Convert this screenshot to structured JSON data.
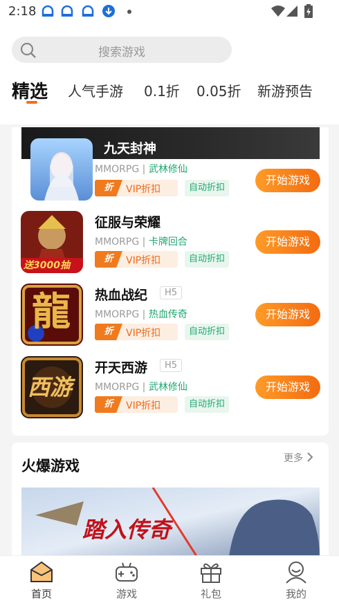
{
  "status_bar": {
    "time": "2:18",
    "notification_icons": [
      "app-notification-icon",
      "app-notification-icon",
      "app-notification-icon",
      "download-icon"
    ],
    "right_icons": [
      "wifi-icon",
      "signal-icon",
      "battery-icon"
    ]
  },
  "search": {
    "placeholder": "搜索游戏",
    "icon": "search-icon"
  },
  "tabs": [
    {
      "label": "精选",
      "active": true
    },
    {
      "label": "人气手游"
    },
    {
      "label": "0.1折"
    },
    {
      "label": "0.05折"
    },
    {
      "label": "新游预告"
    }
  ],
  "featured": {
    "title": "九天封神"
  },
  "games": [
    {
      "name": "九天封神",
      "type": "MMORPG |",
      "genre": "武林修仙",
      "vip_tag": "VIP折扣",
      "zhe": "折",
      "auto_tag": "自动折扣",
      "button": "开始游戏"
    },
    {
      "name": "征服与荣耀",
      "type": "MMORPG |",
      "genre": "卡牌回合",
      "vip_tag": "VIP折扣",
      "zhe": "折",
      "auto_tag": "自动折扣",
      "button": "开始游戏",
      "thumb_text": "送3000抽"
    },
    {
      "name": "热血战纪",
      "badge": "H5",
      "type": "MMORPG |",
      "genre": "热血传奇",
      "vip_tag": "VIP折扣",
      "zhe": "折",
      "auto_tag": "自动折扣",
      "button": "开始游戏",
      "thumb_text": "龍"
    },
    {
      "name": "开天西游",
      "badge": "H5",
      "type": "MMORPG |",
      "genre": "武林修仙",
      "vip_tag": "VIP折扣",
      "zhe": "折",
      "auto_tag": "自动折扣",
      "button": "开始游戏",
      "thumb_text": "西游"
    }
  ],
  "hot": {
    "title": "火爆游戏",
    "more": "更多",
    "banner_text": "踏入传奇"
  },
  "bottom_nav": [
    {
      "label": "首页",
      "icon": "home-icon",
      "active": true
    },
    {
      "label": "游戏",
      "icon": "gamepad-icon"
    },
    {
      "label": "礼包",
      "icon": "gift-icon"
    },
    {
      "label": "我的",
      "icon": "user-icon"
    }
  ],
  "colors": {
    "accent": "#f26d21",
    "green": "#20a870"
  }
}
